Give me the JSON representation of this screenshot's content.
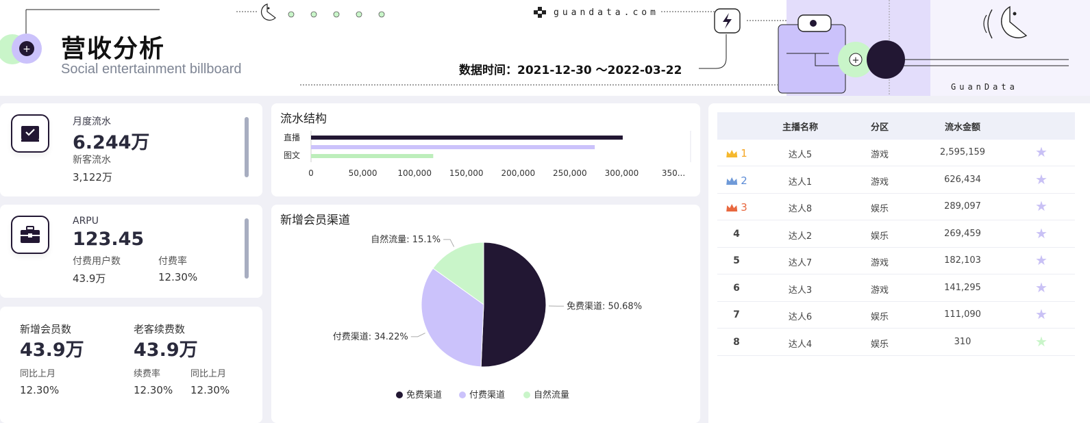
{
  "header": {
    "title": "营收分析",
    "subtitle": "Social entertainment billboard",
    "date_label": "数据时间：",
    "date_range": "2021-12-30  ～2022-03-22",
    "brand_top": "guandata.com",
    "brand_bottom": "GuanData"
  },
  "kpi_monthly": {
    "label": "月度流水",
    "value": "6.244万",
    "sub_label": "新客流水",
    "sub_value": "3,122万"
  },
  "kpi_arpu": {
    "label": "ARPU",
    "value": "123.45",
    "paying_users_label": "付费用户数",
    "paying_users_value": "43.9万",
    "pay_rate_label": "付费率",
    "pay_rate_value": "12.30%"
  },
  "kpi_members": {
    "new_members_label": "新增会员数",
    "new_members_value": "43.9万",
    "renew_label": "老客续费数",
    "renew_value": "43.9万",
    "yoy_label_1": "同比上月",
    "yoy_value_1": "12.30%",
    "renew_rate_label": "续费率",
    "renew_rate_value": "12.30%",
    "yoy_label_2": "同比上月",
    "yoy_value_2": "12.30%"
  },
  "flow_chart": {
    "title": "流水结构"
  },
  "pie_chart": {
    "title": "新增会员渠道"
  },
  "ranking": {
    "headers": [
      "主播名称",
      "分区",
      "流水金额"
    ],
    "rows": [
      {
        "rank": "1",
        "name": "达人5",
        "category": "游戏",
        "amount": "2,595,159"
      },
      {
        "rank": "2",
        "name": "达人1",
        "category": "游戏",
        "amount": "626,434"
      },
      {
        "rank": "3",
        "name": "达人8",
        "category": "娱乐",
        "amount": "289,097"
      },
      {
        "rank": "4",
        "name": "达人2",
        "category": "娱乐",
        "amount": "269,459"
      },
      {
        "rank": "5",
        "name": "达人7",
        "category": "游戏",
        "amount": "182,103"
      },
      {
        "rank": "6",
        "name": "达人3",
        "category": "游戏",
        "amount": "141,295"
      },
      {
        "rank": "7",
        "name": "达人6",
        "category": "娱乐",
        "amount": "111,090"
      },
      {
        "rank": "8",
        "name": "达人4",
        "category": "娱乐",
        "amount": "310"
      }
    ],
    "crown_colors": [
      "#f5b82e",
      "#6f9ad8",
      "#e8683f"
    ],
    "rank_colors": [
      "#f5a623",
      "#5b8bd6",
      "#e8683f"
    ]
  },
  "colors": {
    "dark": "#221733",
    "lavender": "#cbc2fb",
    "mint": "#c9f5c9"
  },
  "chart_data": [
    {
      "type": "bar",
      "orientation": "horizontal",
      "categories": [
        "直播",
        "图文"
      ],
      "series": [
        {
          "values": [
            301000,
            null
          ],
          "color": "#221733"
        },
        {
          "values": [
            274000,
            null
          ],
          "color": "#cbc2fb"
        },
        {
          "values": [
            null,
            118000
          ],
          "color": "#bdeebb"
        }
      ],
      "x_ticks": [
        "0",
        "50,000",
        "100,000",
        "150,000",
        "200,000",
        "250,000",
        "300,000",
        "350..."
      ],
      "xlim": [
        0,
        350000
      ],
      "grid": false
    },
    {
      "type": "pie",
      "slices": [
        {
          "name": "免费渠道",
          "value": 50.68,
          "label": "免费渠道: 50.68%",
          "color": "#221733"
        },
        {
          "name": "付费渠道",
          "value": 34.22,
          "label": "付费渠道: 34.22%",
          "color": "#cbc2fb"
        },
        {
          "name": "自然流量",
          "value": 15.1,
          "label": "自然流量: 15.1%",
          "color": "#c9f5c9"
        }
      ],
      "legend": {
        "position": "bottom",
        "items": [
          "免费渠道",
          "付费渠道",
          "自然流量"
        ]
      }
    }
  ]
}
